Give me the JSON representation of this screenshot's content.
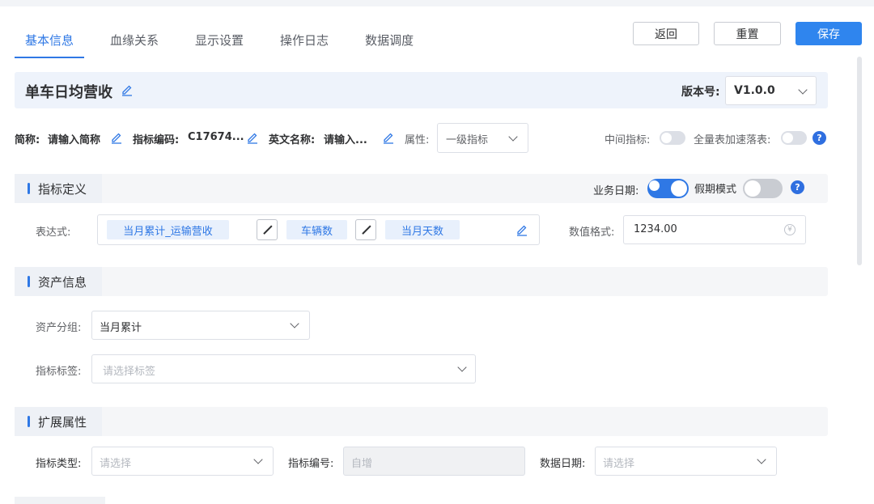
{
  "tabs": [
    {
      "label": "基本信息",
      "active": true
    },
    {
      "label": "血缘关系"
    },
    {
      "label": "显示设置"
    },
    {
      "label": "操作日志"
    },
    {
      "label": "数据调度"
    }
  ],
  "actions": {
    "back": "返回",
    "reset": "重置",
    "save": "保存"
  },
  "header": {
    "title": "单车日均营收",
    "version_label": "版本号:",
    "version_value": "V1.0.0"
  },
  "info": {
    "short_name_label": "简称:",
    "short_name_value": "请输入简称",
    "code_label": "指标编码:",
    "code_value": "C17674...",
    "en_label": "英文名称:",
    "en_value": "请输入...",
    "attr_label": "属性:",
    "attr_value": "一级指标",
    "middle_label": "中间指标:",
    "middle_on": false,
    "full_label": "全量表加速落表:",
    "full_on": false
  },
  "definition": {
    "section": "指标定义",
    "biz_date_label": "业务日期:",
    "biz_date_on": true,
    "holiday_label": "假期模式",
    "holiday_on": false,
    "expr_label": "表达式:",
    "expr_items": [
      "当月累计_运输营收",
      "车辆数",
      "当月天数"
    ],
    "format_label": "数值格式:",
    "format_value": "1234.00"
  },
  "assets": {
    "section": "资产信息",
    "group_label": "资产分组:",
    "group_value": "当月累计",
    "tag_label": "指标标签:",
    "tag_placeholder": "请选择标签"
  },
  "extended": {
    "section": "扩展属性",
    "type_label": "指标类型:",
    "type_placeholder": "请选择",
    "number_label": "指标编号:",
    "number_placeholder": "自增",
    "date_label": "数据日期:",
    "date_placeholder": "请选择"
  },
  "colors": {
    "accent": "#2f78e5",
    "primary_button": "#2f85ee",
    "section_bg": "#f5f6f8"
  }
}
